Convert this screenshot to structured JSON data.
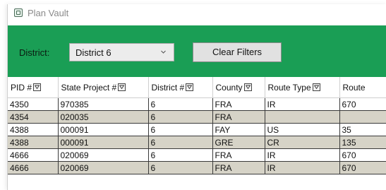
{
  "app": {
    "title": "Plan Vault",
    "icon": "plan-vault-app-icon"
  },
  "filters": {
    "district_label": "District:",
    "district_value": "District 6",
    "clear_label": "Clear Filters"
  },
  "colors": {
    "filterbar": "#1a9e55",
    "alt_row": "#d6d3c7",
    "header_bg": "#ffffff"
  },
  "table": {
    "columns": [
      "PID #",
      "State Project #",
      "District #",
      "County",
      "Route Type",
      "Route"
    ],
    "rows": [
      [
        "4350",
        "970385",
        "6",
        "FRA",
        "IR",
        "670"
      ],
      [
        "4354",
        "020035",
        "6",
        "FRA",
        "",
        ""
      ],
      [
        "4388",
        "000091",
        "6",
        "FAY",
        "US",
        "35"
      ],
      [
        "4388",
        "000091",
        "6",
        "GRE",
        "CR",
        "135"
      ],
      [
        "4666",
        "020069",
        "6",
        "FRA",
        "IR",
        "670"
      ],
      [
        "4666",
        "020069",
        "6",
        "FRA",
        "IR",
        "670"
      ]
    ]
  }
}
